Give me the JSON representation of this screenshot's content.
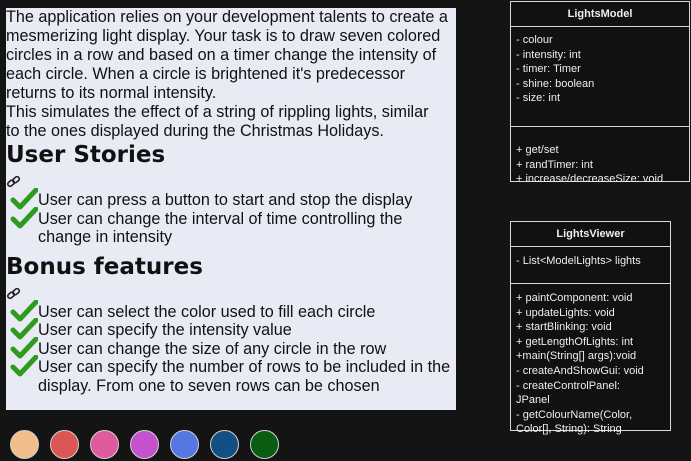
{
  "description": {
    "intro_lines": [
      "The application relies on your development talents to create a",
      "mesmerizing light display. Your task is to draw seven colored",
      "circles in a row and based on a timer change the intensity of",
      "each circle. When a circle is brightened it's predecessor",
      "returns to its normal intensity.",
      "This simulates the effect of a string of rippling lights, similar",
      "to the ones displayed during the Christmas Holidays."
    ]
  },
  "user_stories": {
    "heading": "User Stories",
    "items": [
      "User can press a button to start and stop the display",
      "User can change the interval of time controlling the change in intensity"
    ]
  },
  "bonus": {
    "heading": "Bonus features",
    "items": [
      "User can select the color used to fill each circle",
      "User can specify the intensity value",
      "User can change the size of any circle in the row",
      "User can specify the number of rows to be included in the display. From one to seven rows can be chosen"
    ]
  },
  "icons": {
    "link": "link-icon",
    "check": "check-icon"
  },
  "lights": {
    "colors": [
      "#f2bf8c",
      "#dc5656",
      "#e05a9e",
      "#c552cc",
      "#5577e2",
      "#124f82",
      "#0a5c10"
    ]
  },
  "uml_model": {
    "title": "LightsModel",
    "fields": [
      "- colour",
      "- intensity: int",
      "- timer: Timer",
      "- shine: boolean",
      "- size: int"
    ],
    "methods": [
      "+ get/set",
      "+ randTimer: int",
      "+ increase/decreaseSize: void"
    ]
  },
  "uml_viewer": {
    "title": "LightsViewer",
    "fields": [
      "- List<ModelLights> lights"
    ],
    "methods": [
      "+ paintComponent: void",
      "+ updateLights: void",
      "+ startBlinking: void",
      "+ getLengthOfLights: int",
      "+main(String[] args):void",
      "- createAndShowGui: void",
      "- createControlPanel:",
      "JPanel",
      "- getColourName(Color,",
      "Color[], String): String"
    ]
  },
  "colors": {
    "page_bg": "#141414",
    "panel_bg": "#e8ebf4",
    "check_green": "#2e9b1e"
  }
}
